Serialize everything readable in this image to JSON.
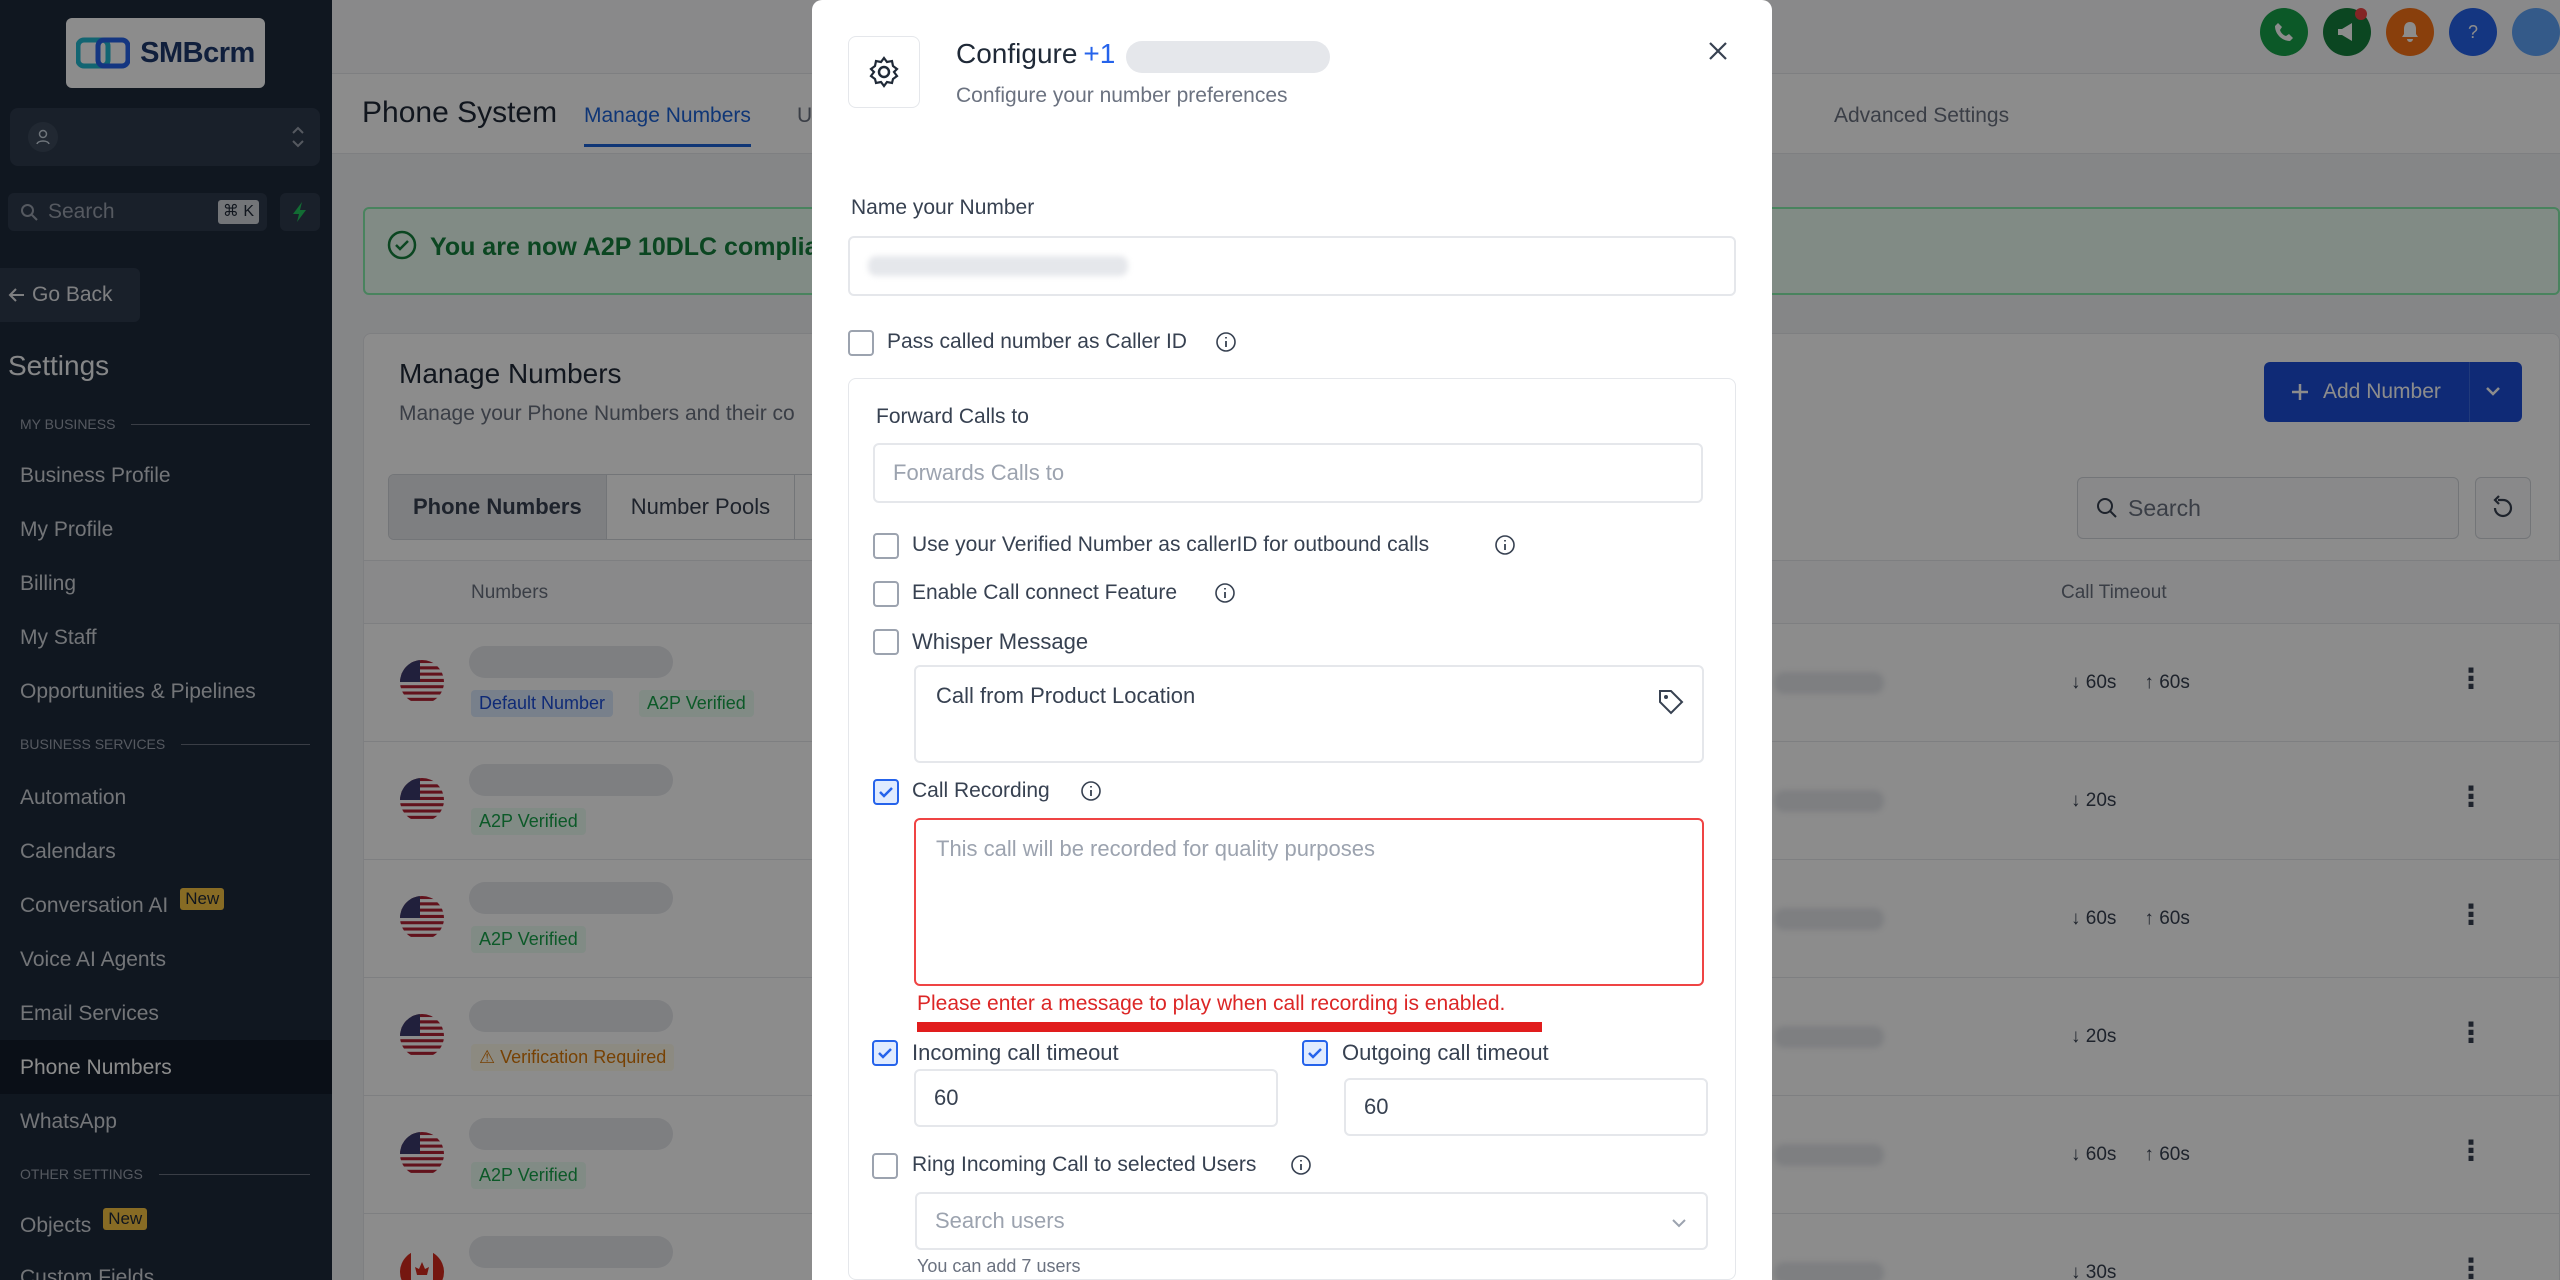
{
  "sidebar": {
    "logo_text": "SMBcrm",
    "search_placeholder": "Search",
    "search_shortcut": "⌘ K",
    "go_back": "Go Back",
    "settings_title": "Settings",
    "sections": {
      "my_business": "MY BUSINESS",
      "business_services": "BUSINESS SERVICES",
      "other_settings": "OTHER SETTINGS"
    },
    "items": {
      "business_profile": "Business Profile",
      "my_profile": "My Profile",
      "billing": "Billing",
      "my_staff": "My Staff",
      "opportunities": "Opportunities & Pipelines",
      "automation": "Automation",
      "calendars": "Calendars",
      "conversation_ai": "Conversation AI",
      "voice_ai": "Voice AI Agents",
      "email_services": "Email Services",
      "phone_numbers": "Phone Numbers",
      "whatsapp": "WhatsApp",
      "objects": "Objects",
      "custom_fields": "Custom Fields"
    },
    "new_badge": "New"
  },
  "header": {
    "title": "Phone System",
    "tabs": [
      "Manage Numbers",
      "U",
      "Advanced Settings"
    ]
  },
  "banner": {
    "text": "You are now A2P 10DLC complian"
  },
  "page": {
    "title": "Manage Numbers",
    "subtitle": "Manage your Phone Numbers and their co",
    "add_button": "Add Number",
    "segments": [
      "Phone Numbers",
      "Number Pools"
    ],
    "search_placeholder": "Search",
    "columns": {
      "numbers": "Numbers",
      "call_timeout": "Call Timeout"
    },
    "rows": [
      {
        "tags": [
          "Default Number",
          "A2P Verified"
        ],
        "in": "60s",
        "out": "60s",
        "flag": "us"
      },
      {
        "tags": [
          "A2P Verified"
        ],
        "in": "20s",
        "out": "",
        "flag": "us"
      },
      {
        "tags": [
          "A2P Verified"
        ],
        "in": "60s",
        "out": "60s",
        "flag": "us"
      },
      {
        "tags": [
          "Verification Required"
        ],
        "in": "20s",
        "out": "",
        "flag": "us"
      },
      {
        "tags": [
          "A2P Verified"
        ],
        "in": "60s",
        "out": "60s",
        "flag": "us"
      },
      {
        "tags": [],
        "in": "30s",
        "out": "",
        "flag": "ca"
      }
    ]
  },
  "modal": {
    "title": "Configure",
    "title_prefix": "+1",
    "subtitle": "Configure your number preferences",
    "name_label": "Name your Number",
    "pass_caller_id": "Pass called number as Caller ID",
    "forward_label": "Forward Calls to",
    "forward_placeholder": "Forwards Calls to",
    "use_verified": "Use your Verified Number as callerID for outbound calls",
    "call_connect": "Enable Call connect Feature",
    "whisper_label": "Whisper Message",
    "whisper_value": "Call from Product Location",
    "call_recording_label": "Call Recording",
    "recording_placeholder": "This call will be recorded for quality purposes",
    "recording_error": "Please enter a message to play when call recording is enabled.",
    "incoming_label": "Incoming call timeout",
    "incoming_value": "60",
    "outgoing_label": "Outgoing call timeout",
    "outgoing_value": "60",
    "ring_label": "Ring Incoming Call to selected Users",
    "search_users_placeholder": "Search users",
    "users_hint": "You can add 7 users"
  },
  "colors": {
    "sidebar_bg": "#1e2a3b",
    "primary": "#1d4ed8",
    "error": "#dc2626",
    "success": "#15803d"
  }
}
